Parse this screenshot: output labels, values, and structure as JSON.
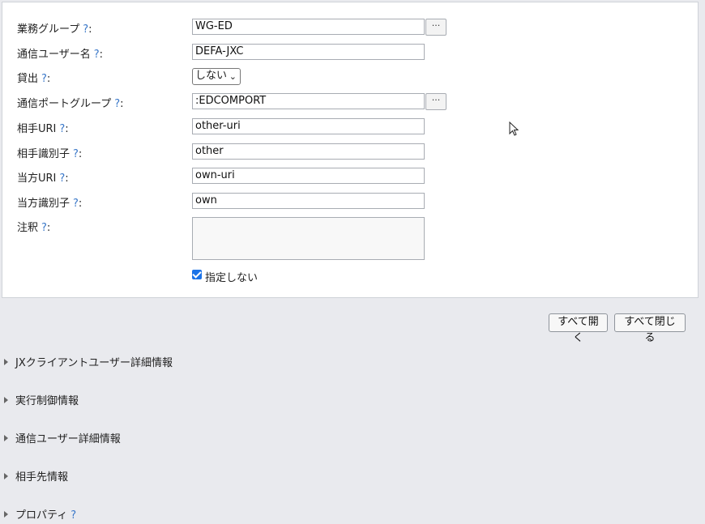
{
  "form": {
    "fields": [
      {
        "label": "業務グループ",
        "value": "WG-ED",
        "has_picker": true
      },
      {
        "label": "通信ユーザー名",
        "value": "DEFA-JXC"
      },
      {
        "label": "貸出",
        "select_value": "しない"
      },
      {
        "label": "通信ポートグループ",
        "value": ":EDCOMPORT",
        "has_picker": true
      },
      {
        "label": "相手URI",
        "value": "other-uri"
      },
      {
        "label": "相手識別子",
        "value": "other"
      },
      {
        "label": "当方URI",
        "value": "own-uri"
      },
      {
        "label": "当方識別子",
        "value": "own"
      },
      {
        "label": "注釈",
        "value": ""
      }
    ],
    "help_mark": "?",
    "colon": ":",
    "picker_label": "···",
    "checkbox_label": "指定しない",
    "checkbox_checked": true
  },
  "buttons": {
    "expand_all": "すべて開く",
    "collapse_all": "すべて閉じる"
  },
  "sections": [
    {
      "label": "JXクライアントユーザー詳細情報"
    },
    {
      "label": "実行制御情報"
    },
    {
      "label": "通信ユーザー詳細情報"
    },
    {
      "label": "相手先情報"
    },
    {
      "label": "プロパティ",
      "has_help": true
    }
  ],
  "colors": {
    "help": "#3a78c9",
    "checkbox": "#1b73e8",
    "background": "#e9eaee"
  }
}
